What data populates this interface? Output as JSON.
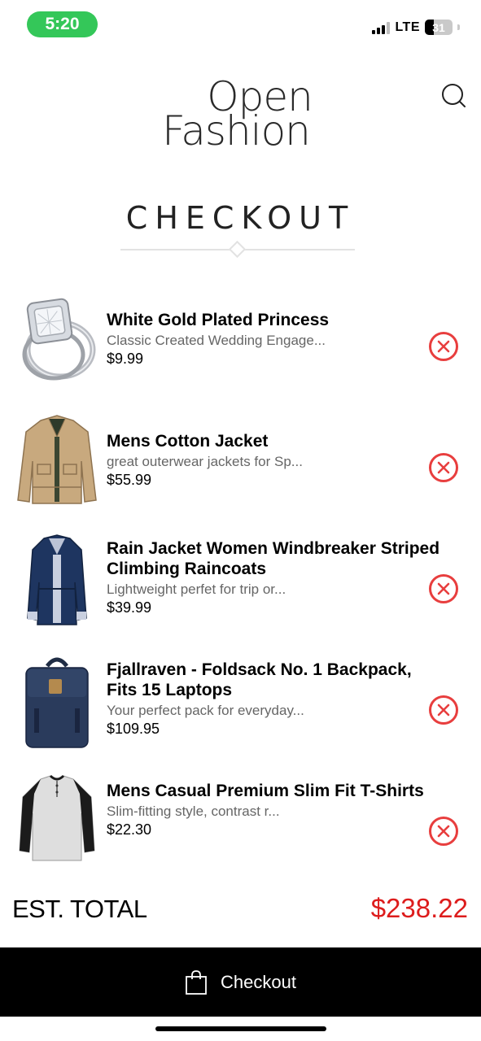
{
  "status_bar": {
    "time": "5:20",
    "network": "LTE",
    "battery_level": "31"
  },
  "header": {
    "logo_line1": "Open",
    "logo_line2": "Fashion",
    "search_icon": "search-icon"
  },
  "page": {
    "title": "CHECKOUT"
  },
  "cart": {
    "items": [
      {
        "name": "White Gold Plated Princess",
        "description": "Classic Created Wedding Engage...",
        "price": "$9.99",
        "image": "ring-image"
      },
      {
        "name": "Mens Cotton Jacket",
        "description": "great outerwear jackets for Sp...",
        "price": "$55.99",
        "image": "jacket-image"
      },
      {
        "name": "Rain Jacket Women Windbreaker Striped Climbing Raincoats",
        "description": "Lightweight perfet for trip or...",
        "price": "$39.99",
        "image": "raincoat-image"
      },
      {
        "name": "Fjallraven - Foldsack No. 1 Backpack, Fits 15 Laptops",
        "description": "Your perfect pack for everyday...",
        "price": "$109.95",
        "image": "backpack-image"
      },
      {
        "name": "Mens Casual Premium Slim Fit T-Shirts",
        "description": "Slim-fitting style, contrast r...",
        "price": "$22.30",
        "image": "tshirt-image"
      }
    ],
    "remove_icon": "remove-circle-icon"
  },
  "summary": {
    "total_label": "EST. TOTAL",
    "total_value": "$238.22"
  },
  "checkout": {
    "label": "Checkout",
    "icon": "shopping-bag-icon"
  },
  "colors": {
    "accent_red": "#dd1c1c",
    "remove_red": "#e83e3e",
    "status_green": "#34c759",
    "checkout_bg": "#000000"
  }
}
